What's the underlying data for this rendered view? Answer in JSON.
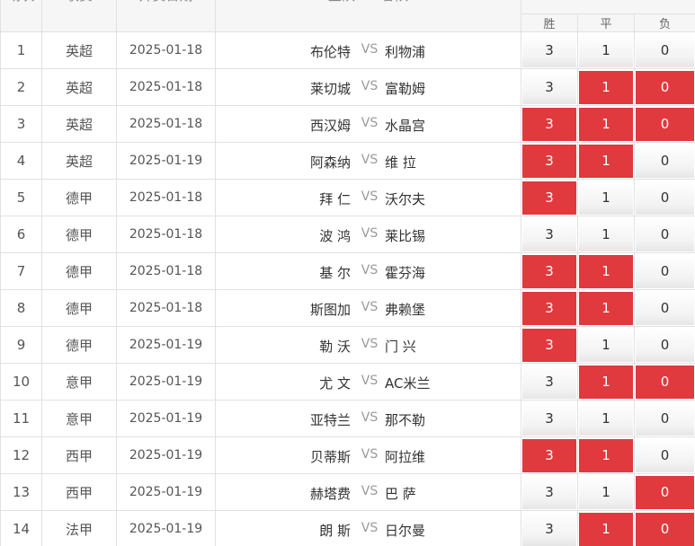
{
  "header": {
    "idx": "场次",
    "league": "联赛",
    "date": "开赛日期",
    "teams": "主队 VS 客队",
    "win": "胜",
    "draw": "平",
    "loss": "负"
  },
  "colors": {
    "selected": "#e0393e",
    "unselected": "#f3f3f3"
  },
  "rows": [
    {
      "idx": "1",
      "league": "英超",
      "date": "2025-01-18",
      "home": "布伦特",
      "vs": "VS",
      "away": "利物浦",
      "win": "3",
      "draw": "1",
      "loss": "0",
      "selected": [
        false,
        false,
        false
      ]
    },
    {
      "idx": "2",
      "league": "英超",
      "date": "2025-01-18",
      "home": "莱切城",
      "vs": "VS",
      "away": "富勒姆",
      "win": "3",
      "draw": "1",
      "loss": "0",
      "selected": [
        false,
        true,
        true
      ]
    },
    {
      "idx": "3",
      "league": "英超",
      "date": "2025-01-18",
      "home": "西汉姆",
      "vs": "VS",
      "away": "水晶宫",
      "win": "3",
      "draw": "1",
      "loss": "0",
      "selected": [
        true,
        true,
        true
      ]
    },
    {
      "idx": "4",
      "league": "英超",
      "date": "2025-01-19",
      "home": "阿森纳",
      "vs": "VS",
      "away": "维 拉",
      "win": "3",
      "draw": "1",
      "loss": "0",
      "selected": [
        true,
        true,
        false
      ]
    },
    {
      "idx": "5",
      "league": "德甲",
      "date": "2025-01-18",
      "home": "拜 仁",
      "vs": "VS",
      "away": "沃尔夫",
      "win": "3",
      "draw": "1",
      "loss": "0",
      "selected": [
        true,
        false,
        false
      ]
    },
    {
      "idx": "6",
      "league": "德甲",
      "date": "2025-01-18",
      "home": "波 鸿",
      "vs": "VS",
      "away": "莱比锡",
      "win": "3",
      "draw": "1",
      "loss": "0",
      "selected": [
        false,
        false,
        false
      ]
    },
    {
      "idx": "7",
      "league": "德甲",
      "date": "2025-01-18",
      "home": "基 尔",
      "vs": "VS",
      "away": "霍芬海",
      "win": "3",
      "draw": "1",
      "loss": "0",
      "selected": [
        true,
        true,
        false
      ]
    },
    {
      "idx": "8",
      "league": "德甲",
      "date": "2025-01-18",
      "home": "斯图加",
      "vs": "VS",
      "away": "弗赖堡",
      "win": "3",
      "draw": "1",
      "loss": "0",
      "selected": [
        true,
        true,
        false
      ]
    },
    {
      "idx": "9",
      "league": "德甲",
      "date": "2025-01-19",
      "home": "勒 沃",
      "vs": "VS",
      "away": "门 兴",
      "win": "3",
      "draw": "1",
      "loss": "0",
      "selected": [
        true,
        false,
        false
      ]
    },
    {
      "idx": "10",
      "league": "意甲",
      "date": "2025-01-19",
      "home": "尤 文",
      "vs": "VS",
      "away": "AC米兰",
      "win": "3",
      "draw": "1",
      "loss": "0",
      "selected": [
        false,
        true,
        true
      ]
    },
    {
      "idx": "11",
      "league": "意甲",
      "date": "2025-01-19",
      "home": "亚特兰",
      "vs": "VS",
      "away": "那不勒",
      "win": "3",
      "draw": "1",
      "loss": "0",
      "selected": [
        false,
        false,
        false
      ]
    },
    {
      "idx": "12",
      "league": "西甲",
      "date": "2025-01-19",
      "home": "贝蒂斯",
      "vs": "VS",
      "away": "阿拉维",
      "win": "3",
      "draw": "1",
      "loss": "0",
      "selected": [
        true,
        true,
        false
      ]
    },
    {
      "idx": "13",
      "league": "西甲",
      "date": "2025-01-19",
      "home": "赫塔费",
      "vs": "VS",
      "away": "巴 萨",
      "win": "3",
      "draw": "1",
      "loss": "0",
      "selected": [
        false,
        false,
        true
      ]
    },
    {
      "idx": "14",
      "league": "法甲",
      "date": "2025-01-19",
      "home": "朗 斯",
      "vs": "VS",
      "away": "日尔曼",
      "win": "3",
      "draw": "1",
      "loss": "0",
      "selected": [
        false,
        true,
        true
      ]
    }
  ]
}
